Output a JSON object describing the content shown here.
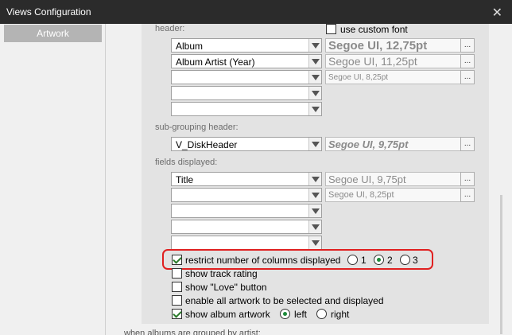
{
  "window": {
    "title": "Views Configuration",
    "close_glyph": "✕"
  },
  "sidebar": {
    "items": [
      {
        "label": "Artwork"
      }
    ]
  },
  "header_section": {
    "label": "header:",
    "use_custom_font_label": "use custom font",
    "use_custom_font_checked": false,
    "combos": [
      "Album",
      "Album Artist (Year)",
      "",
      "",
      ""
    ],
    "fonts": [
      "Segoe UI, 12,75pt",
      "Segoe UI, 11,25pt",
      "Segoe UI, 8,25pt"
    ]
  },
  "subgroup_section": {
    "label": "sub-grouping header:",
    "combo": "V_DiskHeader",
    "font": "Segoe UI, 9,75pt"
  },
  "fields_section": {
    "label": "fields displayed:",
    "combos": [
      "Title",
      "",
      "",
      "",
      ""
    ],
    "fonts": [
      "Segoe UI, 9,75pt",
      "Segoe UI, 8,25pt"
    ]
  },
  "dots_label": "...",
  "options": {
    "restrict_columns": {
      "label": "restrict number of columns displayed",
      "checked": true,
      "choices": [
        "1",
        "2",
        "3"
      ],
      "selected": "2"
    },
    "show_track_rating": {
      "label": "show track rating",
      "checked": false
    },
    "show_love_button": {
      "label": "show \"Love\" button",
      "checked": false
    },
    "enable_all_artwork": {
      "label": "enable all artwork to be selected and displayed",
      "checked": false
    },
    "show_album_artwork": {
      "label": "show album artwork",
      "checked": true,
      "choices": [
        "left",
        "right"
      ],
      "selected": "left"
    }
  },
  "footer_partial_text": "when albums are grouped by artist:"
}
